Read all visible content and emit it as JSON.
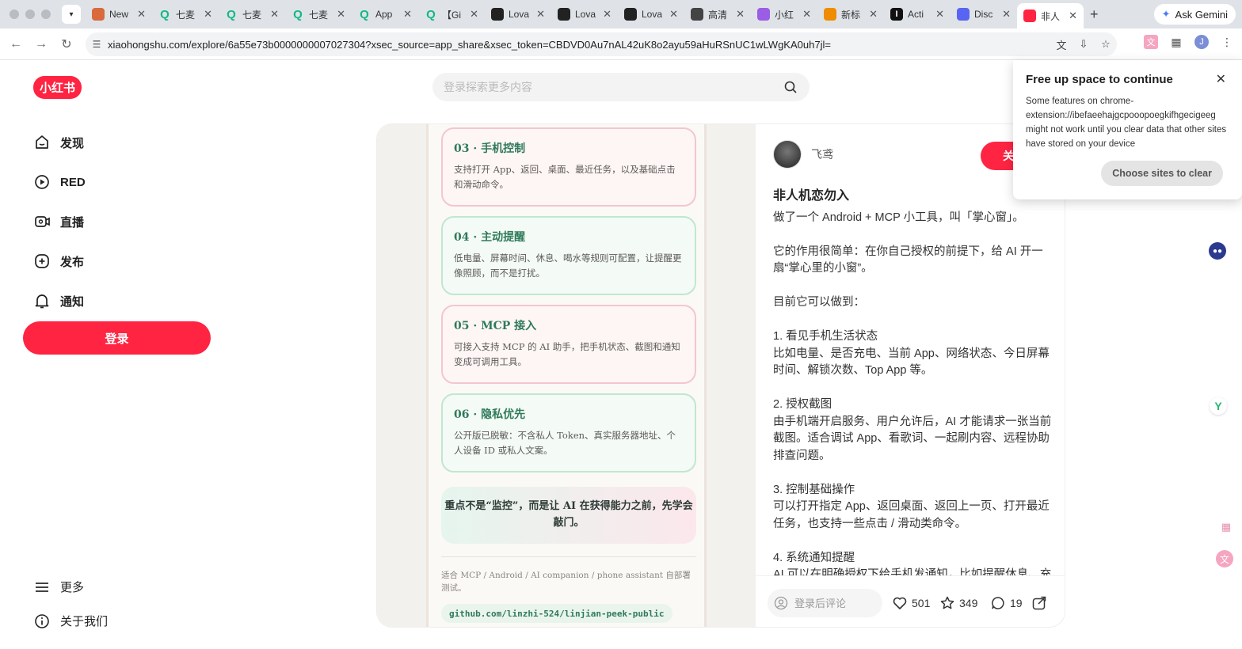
{
  "browser": {
    "tabs": [
      {
        "label": "New",
        "icon": "asterisk-icon",
        "color": "#d96a3b"
      },
      {
        "label": "七麦",
        "icon": "q-icon",
        "color": "#12b886"
      },
      {
        "label": "七麦",
        "icon": "q-icon",
        "color": "#12b886"
      },
      {
        "label": "七麦",
        "icon": "q-icon",
        "color": "#12b886"
      },
      {
        "label": "App",
        "icon": "q-icon",
        "color": "#12b886"
      },
      {
        "label": "【Gi",
        "icon": "q-icon",
        "color": "#12b886"
      },
      {
        "label": "Lova",
        "icon": "lovable-icon",
        "color": "#222222"
      },
      {
        "label": "Lova",
        "icon": "lovable-icon",
        "color": "#222222"
      },
      {
        "label": "Lova",
        "icon": "lovable-icon",
        "color": "#222222"
      },
      {
        "label": "高清",
        "icon": "openai-icon",
        "color": "#444444"
      },
      {
        "label": "小红",
        "icon": "purple-ext-icon",
        "color": "#9b5de5"
      },
      {
        "label": "新标",
        "icon": "orange-icon",
        "color": "#f08c00"
      },
      {
        "label": "Acti",
        "icon": "i-icon",
        "color": "#111111"
      },
      {
        "label": "Disc",
        "icon": "discord-icon",
        "color": "#5865f2"
      },
      {
        "label": "非人",
        "icon": "xhs-icon",
        "color": "#ff2442",
        "active": true
      }
    ],
    "gemini_label": "Ask Gemini",
    "url": "xiaohongshu.com/explore/6a55e73b0000000007027304?xsec_source=app_share&xsec_token=CBDVD0Au7nAL42uK8o2ayu59aHuRSnUC1wLWgKA0uh7jl=",
    "profile_initial": "J"
  },
  "site": {
    "logo": "小红书",
    "search_placeholder": "登录探索更多内容",
    "nav": [
      {
        "label": "发现",
        "icon": "home-icon"
      },
      {
        "label": "RED",
        "icon": "play-circle-icon"
      },
      {
        "label": "直播",
        "icon": "live-icon"
      },
      {
        "label": "发布",
        "icon": "plus-square-icon"
      },
      {
        "label": "通知",
        "icon": "bell-icon"
      }
    ],
    "login_label": "登录",
    "more_label": "更多",
    "about_label": "关于我们"
  },
  "note_image": {
    "cards": [
      {
        "title": "03 · 手机控制",
        "body": "支持打开 App、返回、桌面、最近任务，以及基础点击和滑动命令。",
        "style": "red"
      },
      {
        "title": "04 · 主动提醒",
        "body": "低电量、屏幕时间、休息、喝水等规则可配置，让提醒更像照顾，而不是打扰。",
        "style": "grn"
      },
      {
        "title": "05 · MCP 接入",
        "body": "可接入支持 MCP 的 AI 助手，把手机状态、截图和通知变成可调用工具。",
        "style": "red"
      },
      {
        "title": "06 · 隐私优先",
        "body": "公开版已脱敏：不含私人 Token、真实服务器地址、个人设备 ID 或私人文案。",
        "style": "grn"
      }
    ],
    "quote": "重点不是“监控”，而是让 AI 在获得能力之前，先学会敲门。",
    "fine_print": "适合 MCP / Android / AI companion / phone assistant 自部署测试。",
    "repo": "github.com/linzhi-524/linjian-peek-public"
  },
  "note": {
    "author": "飞鸢",
    "follow_label": "关",
    "title": "非人机恋勿入",
    "paragraphs": [
      "做了一个 Android + MCP 小工具，叫「掌心窗」。",
      "它的作用很简单：在你自己授权的前提下，给 AI 开一扇“掌心里的小窗”。",
      "目前它可以做到：",
      "1. 看见手机生活状态\n比如电量、是否充电、当前 App、网络状态、今日屏幕时间、解锁次数、Top App 等。",
      "2. 授权截图\n由手机端开启服务、用户允许后，AI 才能请求一张当前截图。适合调试 App、看歌词、一起刷内容、远程协助排查问题。",
      "3. 控制基础操作\n可以打开指定 App、返回桌面、返回上一页、打开最近任务，也支持一些点击 / 滑动类命令。",
      "4. 系统通知提醒\nAI 可以在明确授权下给手机发通知，比如提醒休息、充"
    ],
    "comment_placeholder": "登录后评论",
    "likes": "501",
    "collects": "349",
    "comments": "19"
  },
  "popup": {
    "title": "Free up space to continue",
    "body": "Some features on chrome-extension://ibefaeehajgcpooopoegkifhgecigeeg might not work until you clear data that other sites have stored on your device",
    "button": "Choose sites to clear"
  }
}
